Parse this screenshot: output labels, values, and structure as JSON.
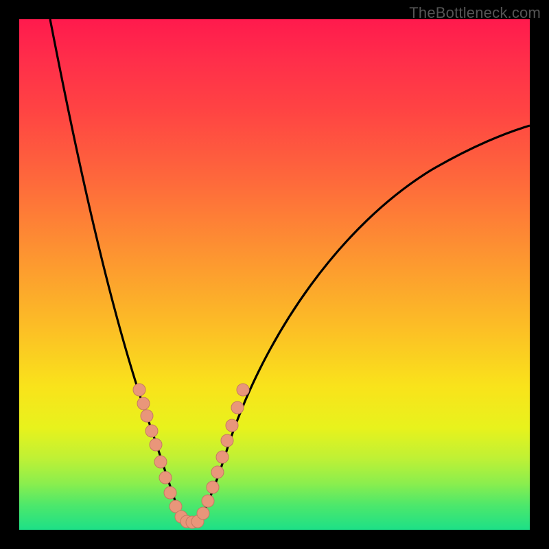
{
  "watermark": "TheBottleneck.com",
  "colors": {
    "frame": "#000000",
    "curve": "#000000",
    "dot_fill": "#e9967a",
    "dot_stroke": "#c57a62"
  },
  "chart_data": {
    "type": "line",
    "title": "",
    "xlabel": "",
    "ylabel": "",
    "xlim": [
      0,
      100
    ],
    "ylim": [
      0,
      100
    ],
    "notes": "Bottleneck-style V-curve. Y is bottleneck %, X is relative component balance. Minimum near x≈32, y≈0. Left branch rises steeply to ~100% at x→0; right branch rises and saturates toward ~70% at x→100. Salmon dots mark sampled configurations clustered around the minimum.",
    "series": [
      {
        "name": "curve_left",
        "x": [
          6,
          8,
          10,
          12,
          14,
          16,
          18,
          20,
          22,
          24,
          26,
          28,
          30,
          31,
          32
        ],
        "y": [
          100,
          90,
          80,
          70,
          60,
          51,
          43,
          36,
          30,
          24,
          18,
          12,
          6,
          3,
          1
        ]
      },
      {
        "name": "curve_right",
        "x": [
          32,
          34,
          36,
          38,
          40,
          44,
          48,
          52,
          56,
          60,
          66,
          72,
          80,
          90,
          100
        ],
        "y": [
          1,
          4,
          8,
          13,
          18,
          27,
          34,
          40,
          45,
          49,
          54,
          58,
          62,
          66,
          69
        ]
      }
    ],
    "scatter": {
      "name": "sampled_points",
      "x": [
        22.5,
        23.5,
        24.0,
        25.0,
        25.5,
        26.5,
        27.5,
        28.0,
        29.0,
        30.0,
        30.5,
        31.0,
        32.0,
        33.0,
        34.0,
        35.0,
        36.0,
        37.0,
        37.5,
        38.5,
        39.0,
        40.0
      ],
      "y": [
        30,
        27,
        25,
        22,
        20,
        16,
        12,
        10,
        7,
        4,
        3,
        2,
        1,
        1.5,
        3,
        5,
        8,
        11,
        14,
        19,
        22,
        26
      ]
    }
  }
}
